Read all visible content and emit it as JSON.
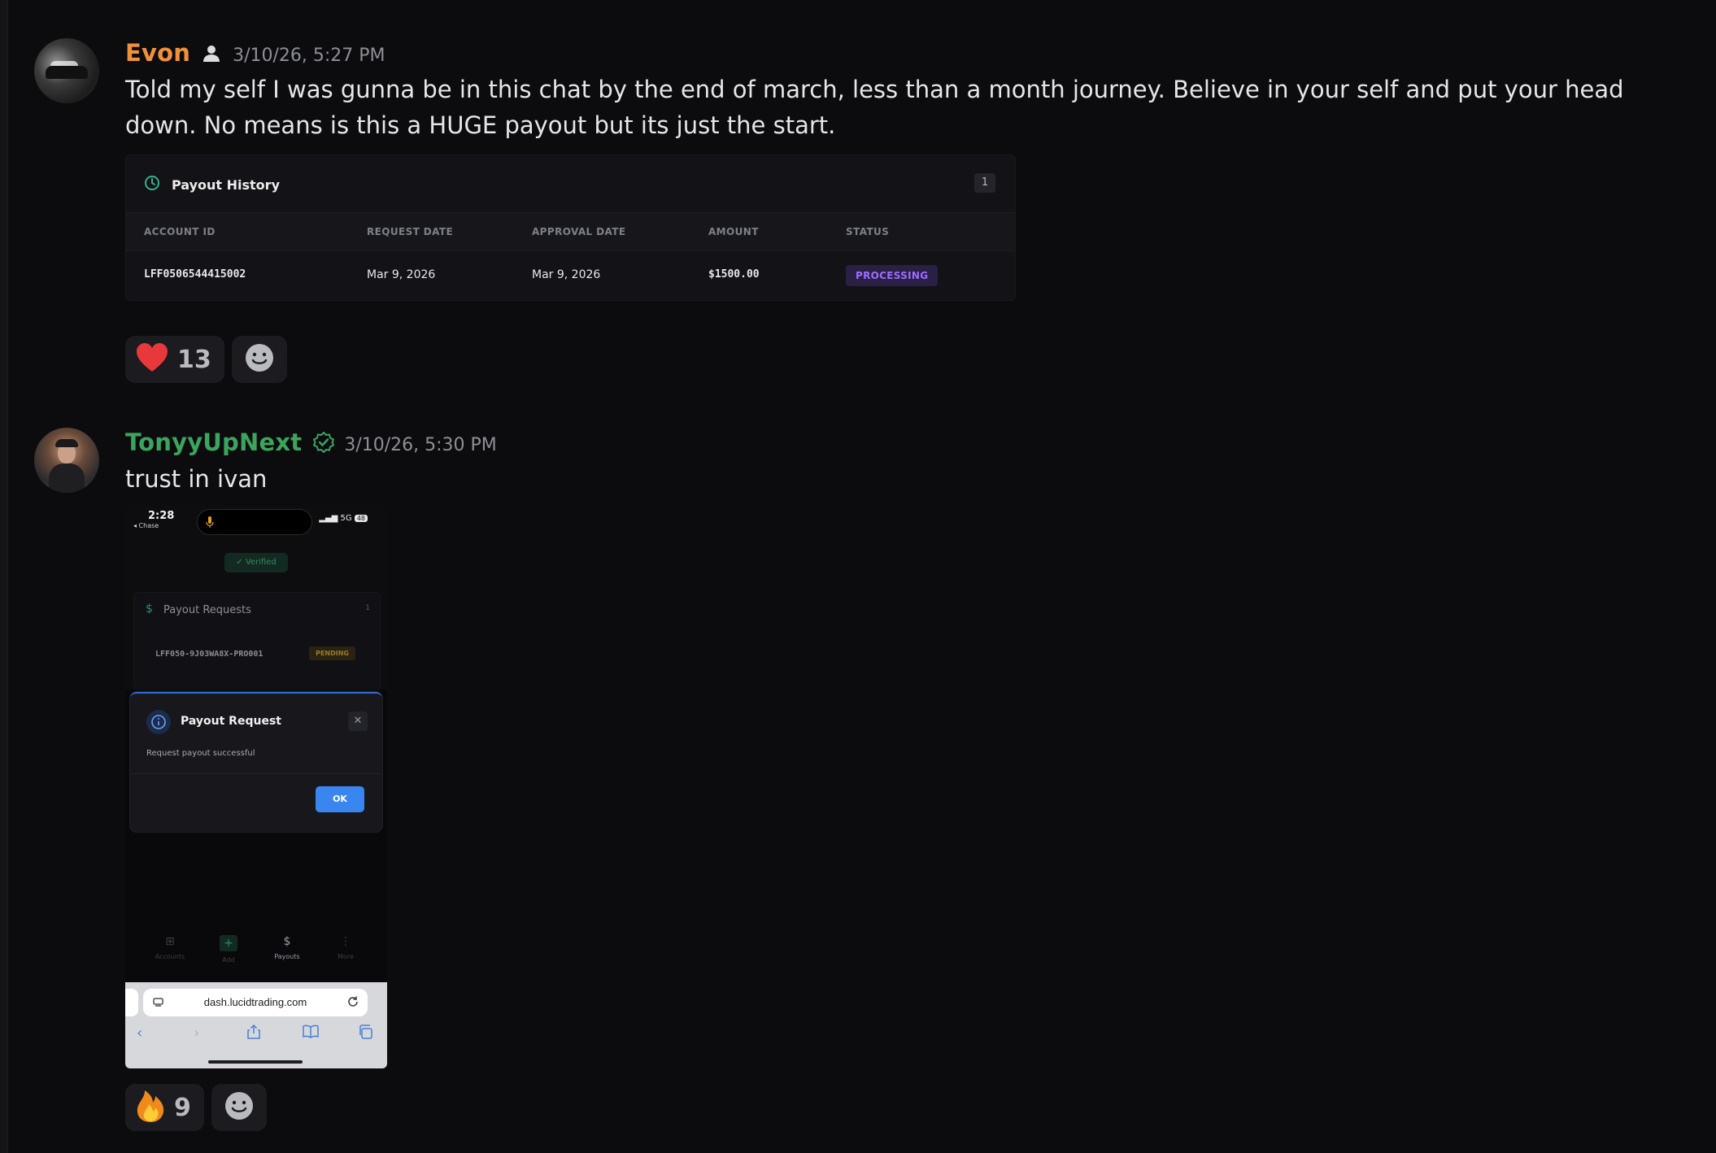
{
  "messages": [
    {
      "author": "Evon",
      "timestamp": "3/10/26, 5:27 PM",
      "text": "Told my self I was gunna be in this chat by the end of march, less than a month journey. Believe in your self and put your head down. No means is this a HUGE payout but its just the start.",
      "attachment": {
        "title": "Payout History",
        "count": "1",
        "columns": [
          "ACCOUNT ID",
          "REQUEST DATE",
          "APPROVAL DATE",
          "AMOUNT",
          "STATUS"
        ],
        "row": {
          "account_id": "LFF0506544415002",
          "request_date": "Mar 9, 2026",
          "approval_date": "Mar 9, 2026",
          "amount": "$1500.00",
          "status": "PROCESSING"
        }
      },
      "reactions": [
        {
          "emoji": "heart",
          "count": "13"
        }
      ]
    },
    {
      "author": "TonyyUpNext",
      "timestamp": "3/10/26, 5:30 PM",
      "text": "trust in ivan",
      "screenshot": {
        "time": "2:28",
        "carrier": "◂ Chase",
        "signal": "5G",
        "battery": "48",
        "verified_label": "Verified",
        "card_title": "Payout Requests",
        "card_count": "1",
        "request_id": "LFF050-9J03WA8X-PRO001",
        "request_status": "PENDING",
        "modal_title": "Payout Request",
        "modal_body": "Request payout successful",
        "modal_ok": "OK",
        "nav": [
          "Accounts",
          "Add",
          "Payouts",
          "More"
        ],
        "url": "dash.lucidtrading.com"
      },
      "reactions": [
        {
          "emoji": "fire",
          "count": "9"
        }
      ]
    }
  ],
  "colors": {
    "background": "#0c0c0f",
    "author1": "#f0913a",
    "author2": "#3ba55d",
    "status_processing": "#9f6cff",
    "ok_button": "#3a86f0"
  }
}
